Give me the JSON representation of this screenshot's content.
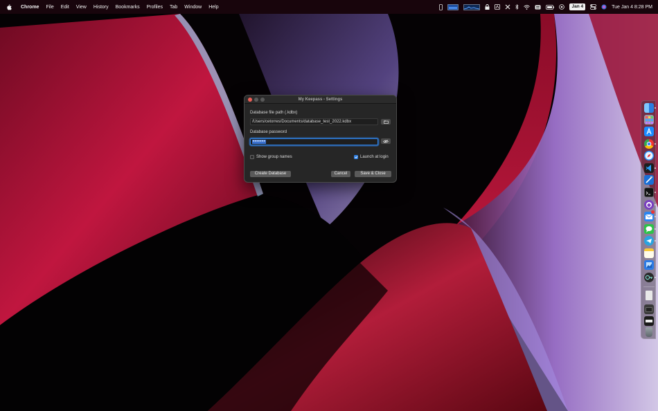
{
  "menubar": {
    "app_name": "Chrome",
    "items": [
      "File",
      "Edit",
      "View",
      "History",
      "Bookmarks",
      "Profiles",
      "Tab",
      "Window",
      "Help"
    ],
    "date_badge": "Jan 4",
    "clock": "Tue Jan 4  8:28 PM"
  },
  "dialog": {
    "title": "My Keepass - Settings",
    "db_path_label": "Database file path (.kdbx)",
    "db_path_value": "/Users/cetorres/Documents/database_test_2022.kdbx",
    "db_password_label": "Database password",
    "db_password_value": "•••••••",
    "show_group_names_label": "Show group names",
    "show_group_names_checked": false,
    "launch_at_login_label": "Launch at login",
    "launch_at_login_checked": true,
    "create_database_label": "Create Database",
    "cancel_label": "Cancel",
    "save_close_label": "Save & Close"
  },
  "dock": {
    "apps": [
      "finder-icon",
      "launchpad-icon",
      "app-store-icon",
      "chrome-icon",
      "safari-icon",
      "vscode-icon",
      "xcode-icon",
      "terminal-icon",
      "github-desktop-icon",
      "mail-icon",
      "messages-icon",
      "telegram-icon",
      "notes-icon",
      "preview-icon",
      "keepass-icon"
    ],
    "mail_badge": true
  },
  "colors": {
    "accent": "#2f7fe0",
    "wallpaper_red": "#b3143a",
    "wallpaper_purple": "#8a6fd0"
  }
}
